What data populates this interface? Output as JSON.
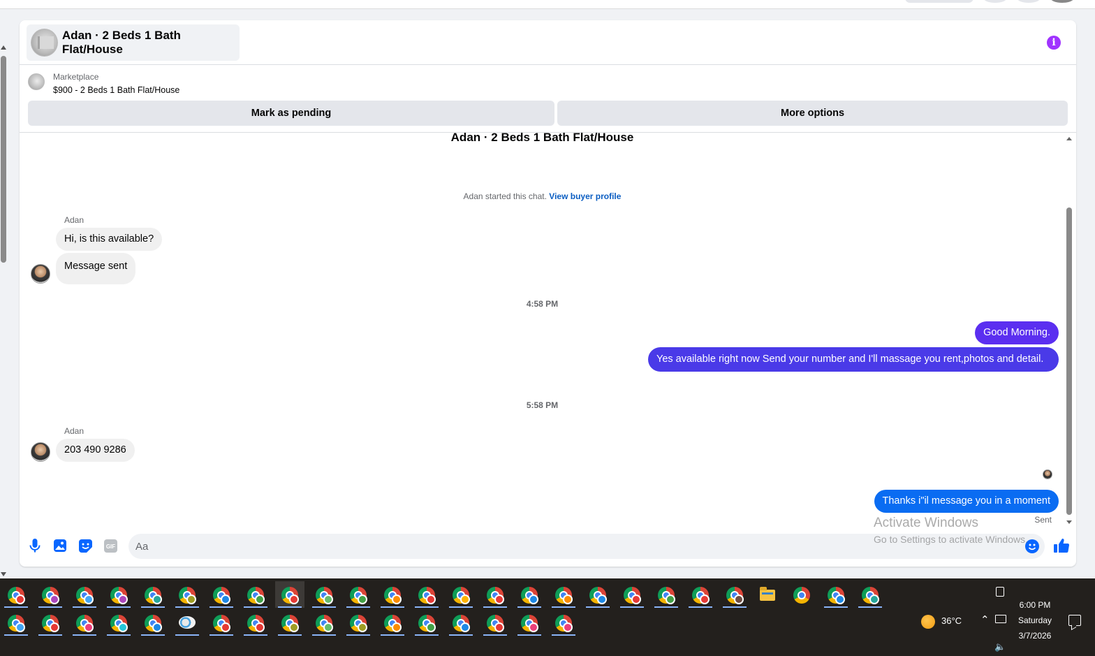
{
  "conversation": {
    "title": "Adan · 2 Beds 1 Bath Flat/House",
    "info_icon": "info-icon"
  },
  "marketplace": {
    "label": "Marketplace",
    "listing": "$900 - 2 Beds 1 Bath Flat/House",
    "mark_pending": "Mark as pending",
    "more_options": "More options"
  },
  "chat": {
    "listing_title": "Adan · 2 Beds 1 Bath Flat/House",
    "started_text": "Adan started this chat. ",
    "view_profile": "View buyer profile",
    "messages": [
      {
        "sender": "Adan",
        "text": "Hi, is this available?"
      },
      {
        "text": "Message sent"
      },
      {
        "timestamp": "4:58 PM"
      },
      {
        "text": "Good Morning.",
        "outgoing": true
      },
      {
        "text": "Yes available right now Send your number and I'll massage you rent,photos and detail.",
        "outgoing": true
      },
      {
        "timestamp": "5:58 PM"
      },
      {
        "sender": "Adan",
        "text": "203 490 9286"
      },
      {
        "text": "Thanks i\"il message you in a moment",
        "outgoing": true
      }
    ],
    "sent_status": "Sent"
  },
  "composer": {
    "placeholder": "Aa",
    "icons": [
      "microphone-icon",
      "image-icon",
      "sticker-icon",
      "gif-icon",
      "emoji-icon",
      "thumbs-up-icon"
    ],
    "gif_label": "GIF"
  },
  "watermark": {
    "line1": "Activate Windows",
    "line2": "Go to Settings to activate Windows."
  },
  "taskbar": {
    "weather": "36°C",
    "time": "6:00 PM",
    "day": "Saturday",
    "date": "3/7/2026"
  },
  "colors": {
    "outgoing_purple": "#5b2ff0",
    "outgoing_blue": "#0a6cf2",
    "messenger_blue": "#0866ff",
    "info_purple": "#a033ff"
  }
}
